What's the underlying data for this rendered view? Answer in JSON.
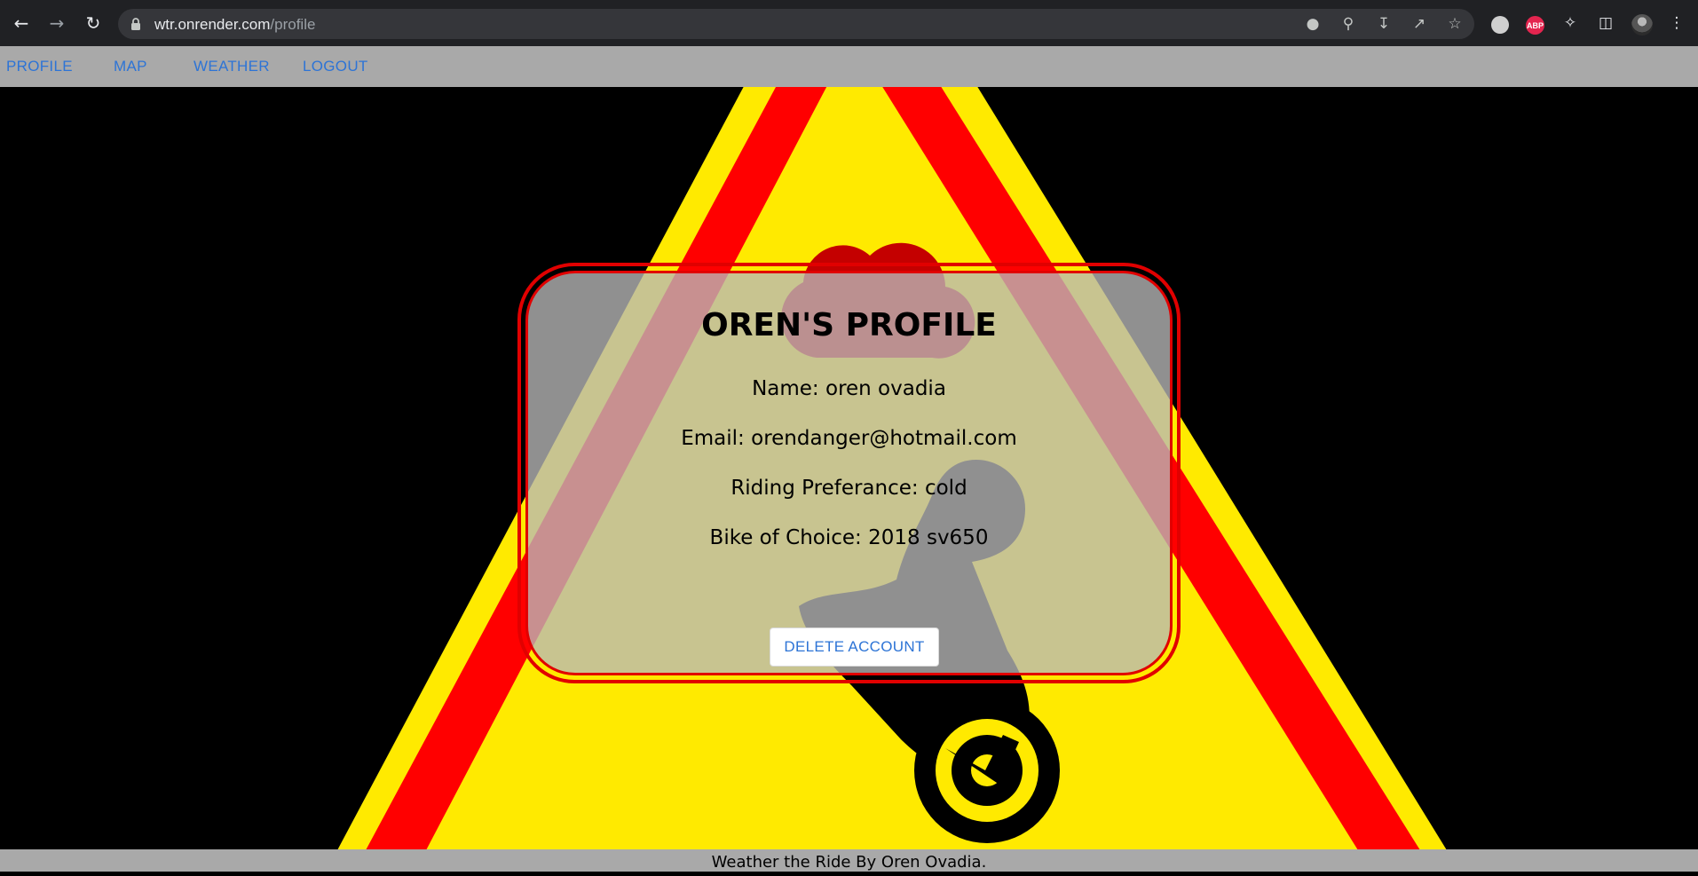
{
  "browser": {
    "url_host": "wtr.onrender.com",
    "url_path": "/profile"
  },
  "nav": {
    "items": [
      {
        "label": "PROFILE"
      },
      {
        "label": "MAP"
      },
      {
        "label": "WEATHER"
      },
      {
        "label": "LOGOUT"
      }
    ]
  },
  "profile": {
    "title": "OREN'S PROFILE",
    "name": "Name: oren ovadia",
    "email": "Email: orendanger@hotmail.com",
    "riding_preference": "Riding Preferance: cold",
    "bike": "Bike of Choice: 2018 sv650",
    "delete_label": "DELETE ACCOUNT"
  },
  "footer": {
    "text": "Weather the Ride By Oren Ovadia."
  },
  "extensions": {
    "abp_label": "ABP"
  },
  "colors": {
    "nav_link": "#2d74d6",
    "appbar_bg": "#a9a9a9",
    "sign_yellow": "#ffea00",
    "sign_red": "#ff0000",
    "card_border": "#e10000"
  }
}
